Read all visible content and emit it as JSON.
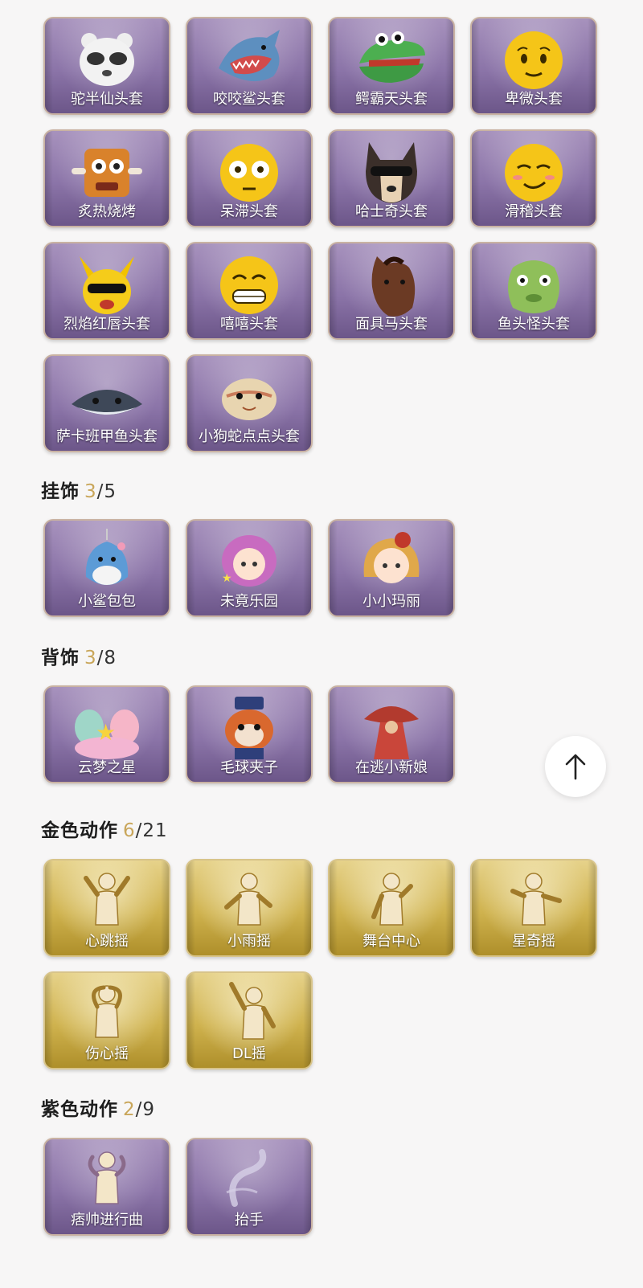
{
  "sections": [
    {
      "title": "",
      "have": "",
      "total": "",
      "items": [
        {
          "label": "驼半仙头套",
          "icon": "raccoon-mask-icon"
        },
        {
          "label": "咬咬鲨头套",
          "icon": "shark-mask-icon"
        },
        {
          "label": "鳄霸天头套",
          "icon": "crocodile-mask-icon"
        },
        {
          "label": "卑微头套",
          "icon": "emoji-face-icon"
        },
        {
          "label": "炙热烧烤",
          "icon": "barbecue-mask-icon"
        },
        {
          "label": "呆滞头套",
          "icon": "emoji-face-icon"
        },
        {
          "label": "哈士奇头套",
          "icon": "husky-mask-icon"
        },
        {
          "label": "滑稽头套",
          "icon": "emoji-face-icon"
        },
        {
          "label": "烈焰红唇头套",
          "icon": "pikachu-mask-icon"
        },
        {
          "label": "嘻嘻头套",
          "icon": "emoji-face-icon"
        },
        {
          "label": "面具马头套",
          "icon": "horse-mask-icon"
        },
        {
          "label": "鱼头怪头套",
          "icon": "fish-mask-icon"
        },
        {
          "label": "萨卡班甲鱼头套",
          "icon": "fish-mask-icon"
        },
        {
          "label": "小狗蛇点点头套",
          "icon": "snake-mask-icon"
        }
      ]
    },
    {
      "title": "挂饰",
      "have": "3",
      "total": "/5",
      "items": [
        {
          "label": "小鲨包包",
          "icon": "shark-pendant-icon"
        },
        {
          "label": "未竟乐园",
          "icon": "doll-pendant-icon"
        },
        {
          "label": "小小玛丽",
          "icon": "doll-pendant-icon"
        }
      ]
    },
    {
      "title": "背饰",
      "have": "3",
      "total": "/8",
      "items": [
        {
          "label": "云梦之星",
          "icon": "star-cloud-backpack-icon"
        },
        {
          "label": "毛球夹子",
          "icon": "raccoon-backpack-icon"
        },
        {
          "label": "在逃小新娘",
          "icon": "bride-backpack-icon"
        }
      ]
    },
    {
      "title": "金色动作",
      "have": "6",
      "total": "/21",
      "items": [
        {
          "label": "心跳摇",
          "icon": "dance-pose-icon"
        },
        {
          "label": "小雨摇",
          "icon": "dance-pose-icon"
        },
        {
          "label": "舞台中心",
          "icon": "dance-pose-icon"
        },
        {
          "label": "星奇摇",
          "icon": "dance-pose-icon"
        },
        {
          "label": "伤心摇",
          "icon": "dance-pose-icon"
        },
        {
          "label": "DL摇",
          "icon": "dance-pose-icon"
        }
      ]
    },
    {
      "title": "紫色动作",
      "have": "2",
      "total": "/9",
      "items": [
        {
          "label": "痞帅进行曲",
          "icon": "dance-pose-icon"
        },
        {
          "label": "抬手",
          "icon": "dance-pose-icon"
        }
      ]
    }
  ],
  "scroll_top": {
    "icon": "arrow-up-icon"
  },
  "colors": {
    "owned_count": "#c9a65a",
    "purple_card": "#8b74a8",
    "gold_card": "#cfb24e"
  }
}
